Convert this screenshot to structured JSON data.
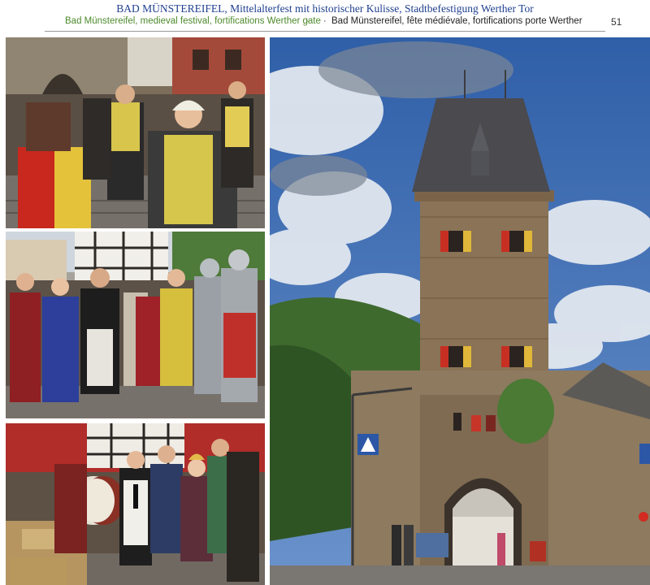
{
  "header": {
    "title_de": "BAD MÜNSTEREIFEL, Mittelalterfest mit historischer Kulisse,  Stadtbefestigung Werther Tor",
    "subtitle_en": "Bad Münstereifel, medieval festival, fortifications Werther gate",
    "subtitle_fr": "Bad Münstereifel, fête médiévale, fortifications porte Werther",
    "separator": "·",
    "page_number": "51"
  },
  "photos": [
    {
      "subject": "festival-procession-photo"
    },
    {
      "subject": "costumed-group-photo"
    },
    {
      "subject": "musicians-drum-photo"
    },
    {
      "subject": "werther-gate-tower-photo"
    }
  ],
  "colors": {
    "title_blue": "#1f3f8f",
    "subtitle_green": "#4d8a2c",
    "sky": "#3f6fb5",
    "stone": "#8a7356",
    "roof": "#4a4a4f"
  }
}
